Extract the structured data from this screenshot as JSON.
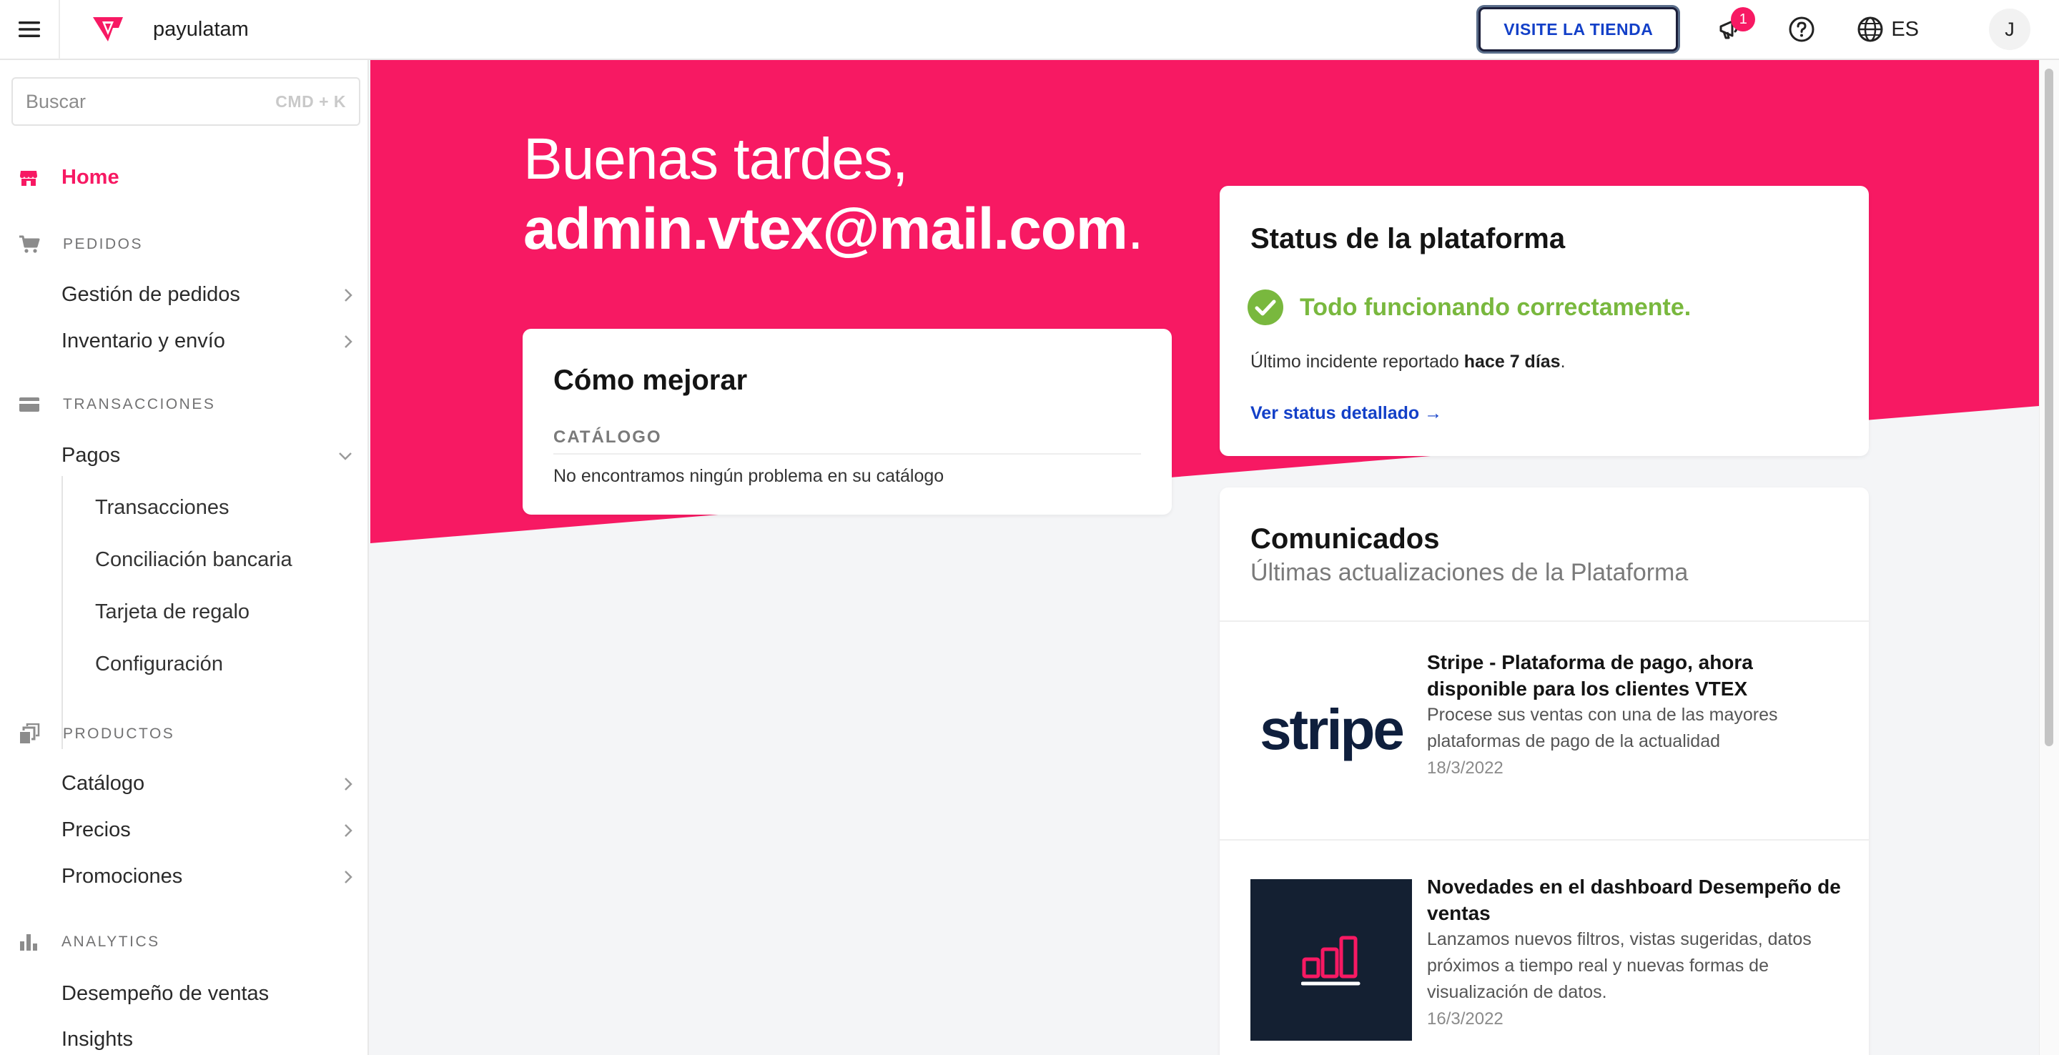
{
  "topbar": {
    "account_name": "payulatam",
    "store_button": "VISITE LA TIENDA",
    "notifications_count": "1",
    "language": "ES",
    "avatar_initial": "J"
  },
  "sidebar": {
    "search_placeholder": "Buscar",
    "search_shortcut": "CMD + K",
    "home": "Home",
    "sections": {
      "pedidos": "PEDIDOS",
      "transacciones": "TRANSACCIONES",
      "productos": "PRODUCTOS",
      "analytics": "ANALYTICS"
    },
    "items": {
      "gestion_pedidos": "Gestión de pedidos",
      "inventario": "Inventario y envío",
      "pagos": "Pagos",
      "catalogo": "Catálogo",
      "precios": "Precios",
      "promociones": "Promociones",
      "desempeno": "Desempeño de ventas",
      "insights": "Insights"
    },
    "pagos_sub": {
      "transacciones": "Transacciones",
      "conciliacion": "Conciliación bancaria",
      "tarjeta": "Tarjeta de regalo",
      "configuracion": "Configuración"
    }
  },
  "greeting": {
    "line1": "Buenas tardes,",
    "email": "admin.vtex@mail.com",
    "dot": "."
  },
  "improve_card": {
    "title": "Cómo mejorar",
    "category": "CATÁLOGO",
    "message": "No encontramos ningún problema en su catálogo"
  },
  "status_card": {
    "title": "Status de la plataforma",
    "ok_text": "Todo funcionando correctamente.",
    "incident_prefix": "Último incidente reportado ",
    "incident_when": "hace 7 días",
    "incident_suffix": ".",
    "link": "Ver status detallado →"
  },
  "news_card": {
    "title": "Comunicados",
    "subtitle": "Últimas actualizaciones de la Plataforma",
    "items": [
      {
        "thumb_text": "stripe",
        "title": "Stripe - Plataforma de pago, ahora disponible para los clientes VTEX",
        "desc": "Procese sus ventas con una de las mayores plataformas de pago de la actualidad",
        "date": "18/3/2022"
      },
      {
        "thumb_icon": "bar-chart-icon",
        "title": "Novedades en el dashboard Desempeño de ventas",
        "desc": "Lanzamos nuevos filtros, vistas sugeridas, datos próximos a tiempo real y nuevas formas de visualización de datos.",
        "date": "16/3/2022"
      }
    ]
  },
  "colors": {
    "brand_pink": "#f71963",
    "link_blue": "#1340c8",
    "ok_green": "#79b83e",
    "thumb_navy": "#142032"
  }
}
